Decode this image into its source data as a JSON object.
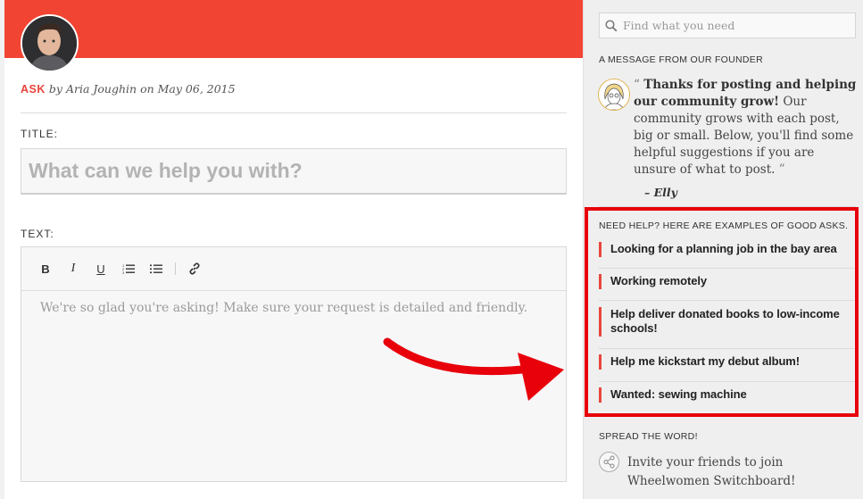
{
  "post": {
    "type_label": "ASK",
    "by": "by",
    "author": "Aria Joughin",
    "on": "on",
    "date": "May 06, 2015"
  },
  "form": {
    "title_label": "TITLE:",
    "title_placeholder": "What can we help you with?",
    "text_label": "TEXT:",
    "text_placeholder": "We're so glad you're asking! Make sure your request is detailed and friendly.",
    "toolbar": {
      "bold": "B",
      "italic": "I",
      "underline": "U"
    }
  },
  "sidebar": {
    "search_placeholder": "Find what you need",
    "founder": {
      "heading": "A MESSAGE FROM OUR FOUNDER",
      "quote_open": "“",
      "quote_bold": "Thanks for posting and helping our community grow!",
      "quote_rest": " Our community grows with each post, big or small. Below, you'll find some helpful suggestions if you are unsure of what to post. ",
      "quote_close": "”",
      "signature": "– Elly"
    },
    "examples": {
      "heading": "NEED HELP? HERE ARE EXAMPLES OF GOOD ASKS.",
      "items": [
        "Looking for a planning job in the bay area",
        "Working remotely",
        "Help deliver donated books to low-income schools!",
        "Help me kickstart my debut album!",
        "Wanted: sewing machine"
      ]
    },
    "spread": {
      "heading": "SPREAD THE WORD!",
      "invite": "Invite your friends to join Wheelwomen Switchboard!"
    }
  },
  "colors": {
    "brand_red": "#f24432",
    "accent_red": "#e8453c",
    "annotation_red": "#e8000b"
  }
}
